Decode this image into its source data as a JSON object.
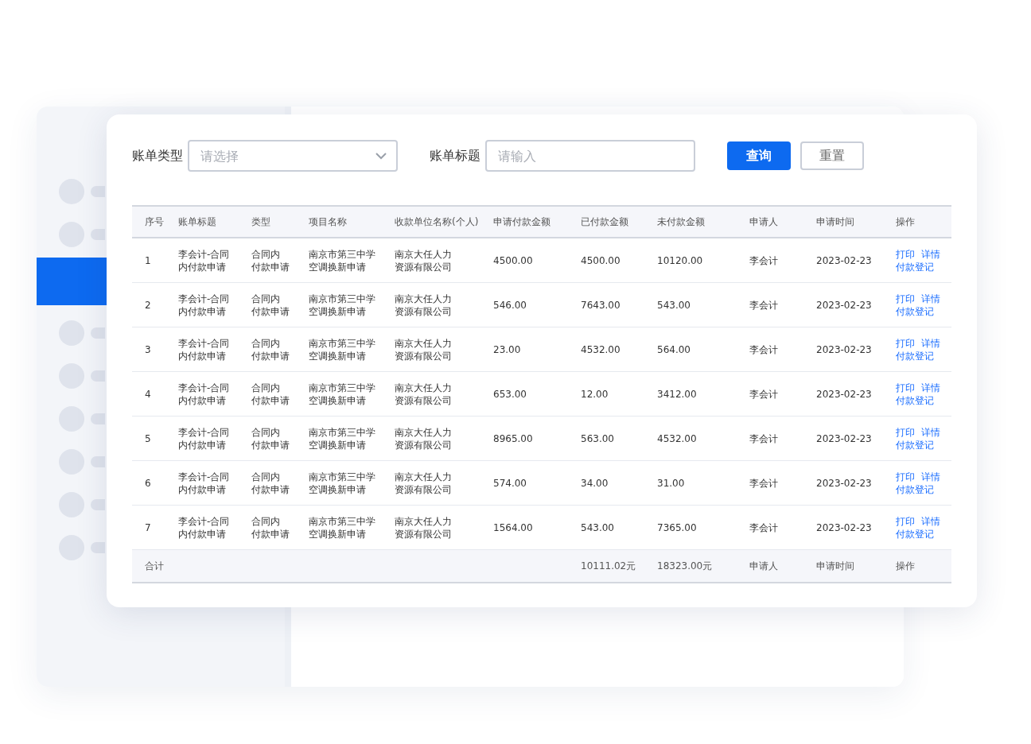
{
  "sidebar": {
    "items": [
      {
        "selected": false
      },
      {
        "selected": false
      },
      {
        "selected": true
      },
      {
        "selected": false
      },
      {
        "selected": false
      },
      {
        "selected": false
      },
      {
        "selected": false
      },
      {
        "selected": false
      },
      {
        "selected": false
      }
    ]
  },
  "filters": [
    {
      "kind": "select",
      "label": "账单类型",
      "placeholder": "请选择"
    },
    {
      "kind": "input",
      "label": "账单标题",
      "placeholder": "请输入"
    }
  ],
  "buttons": [
    {
      "kind": "primary",
      "label": "查询"
    },
    {
      "kind": "default",
      "label": "重置"
    }
  ],
  "table": {
    "columns": [
      "序号",
      "账单标题",
      "类型",
      "项目名称",
      "收款单位名称(个人)",
      "申请付款金额",
      "已付款金额",
      "未付款金额",
      "申请人",
      "申请时间",
      "操作"
    ],
    "rows": [
      {
        "cells": [
          "1",
          [
            "李会计-合同",
            "内付款申请"
          ],
          [
            "合同内",
            "付款申请"
          ],
          [
            "南京市第三中学",
            "空调换新申请"
          ],
          [
            "南京大任人力",
            "资源有限公司"
          ],
          "4500.00",
          "4500.00",
          "10120.00",
          "李会计",
          "2023-02-23"
        ],
        "actions": [
          "打印",
          "详情",
          "付款登记"
        ]
      },
      {
        "cells": [
          "2",
          [
            "李会计-合同",
            "内付款申请"
          ],
          [
            "合同内",
            "付款申请"
          ],
          [
            "南京市第三中学",
            "空调换新申请"
          ],
          [
            "南京大任人力",
            "资源有限公司"
          ],
          "546.00",
          "7643.00",
          "543.00",
          "李会计",
          "2023-02-23"
        ],
        "actions": [
          "打印",
          "详情",
          "付款登记"
        ]
      },
      {
        "cells": [
          "3",
          [
            "李会计-合同",
            "内付款申请"
          ],
          [
            "合同内",
            "付款申请"
          ],
          [
            "南京市第三中学",
            "空调换新申请"
          ],
          [
            "南京大任人力",
            "资源有限公司"
          ],
          "23.00",
          "4532.00",
          "564.00",
          "李会计",
          "2023-02-23"
        ],
        "actions": [
          "打印",
          "详情",
          "付款登记"
        ]
      },
      {
        "cells": [
          "4",
          [
            "李会计-合同",
            "内付款申请"
          ],
          [
            "合同内",
            "付款申请"
          ],
          [
            "南京市第三中学",
            "空调换新申请"
          ],
          [
            "南京大任人力",
            "资源有限公司"
          ],
          "653.00",
          "12.00",
          "3412.00",
          "李会计",
          "2023-02-23"
        ],
        "actions": [
          "打印",
          "详情",
          "付款登记"
        ]
      },
      {
        "cells": [
          "5",
          [
            "李会计-合同",
            "内付款申请"
          ],
          [
            "合同内",
            "付款申请"
          ],
          [
            "南京市第三中学",
            "空调换新申请"
          ],
          [
            "南京大任人力",
            "资源有限公司"
          ],
          "8965.00",
          "563.00",
          "4532.00",
          "李会计",
          "2023-02-23"
        ],
        "actions": [
          "打印",
          "详情",
          "付款登记"
        ]
      },
      {
        "cells": [
          "6",
          [
            "李会计-合同",
            "内付款申请"
          ],
          [
            "合同内",
            "付款申请"
          ],
          [
            "南京市第三中学",
            "空调换新申请"
          ],
          [
            "南京大任人力",
            "资源有限公司"
          ],
          "574.00",
          "34.00",
          "31.00",
          "李会计",
          "2023-02-23"
        ],
        "actions": [
          "打印",
          "详情",
          "付款登记"
        ]
      },
      {
        "cells": [
          "7",
          [
            "李会计-合同",
            "内付款申请"
          ],
          [
            "合同内",
            "付款申请"
          ],
          [
            "南京市第三中学",
            "空调换新申请"
          ],
          [
            "南京大任人力",
            "资源有限公司"
          ],
          "1564.00",
          "543.00",
          "7365.00",
          "李会计",
          "2023-02-23"
        ],
        "actions": [
          "打印",
          "详情",
          "付款登记"
        ]
      }
    ],
    "footer": {
      "label": "合计",
      "paid_total": "10111.02元",
      "unpaid_total": "18323.00元",
      "applicant": "申请人",
      "time": "申请时间",
      "action": "操作"
    }
  }
}
